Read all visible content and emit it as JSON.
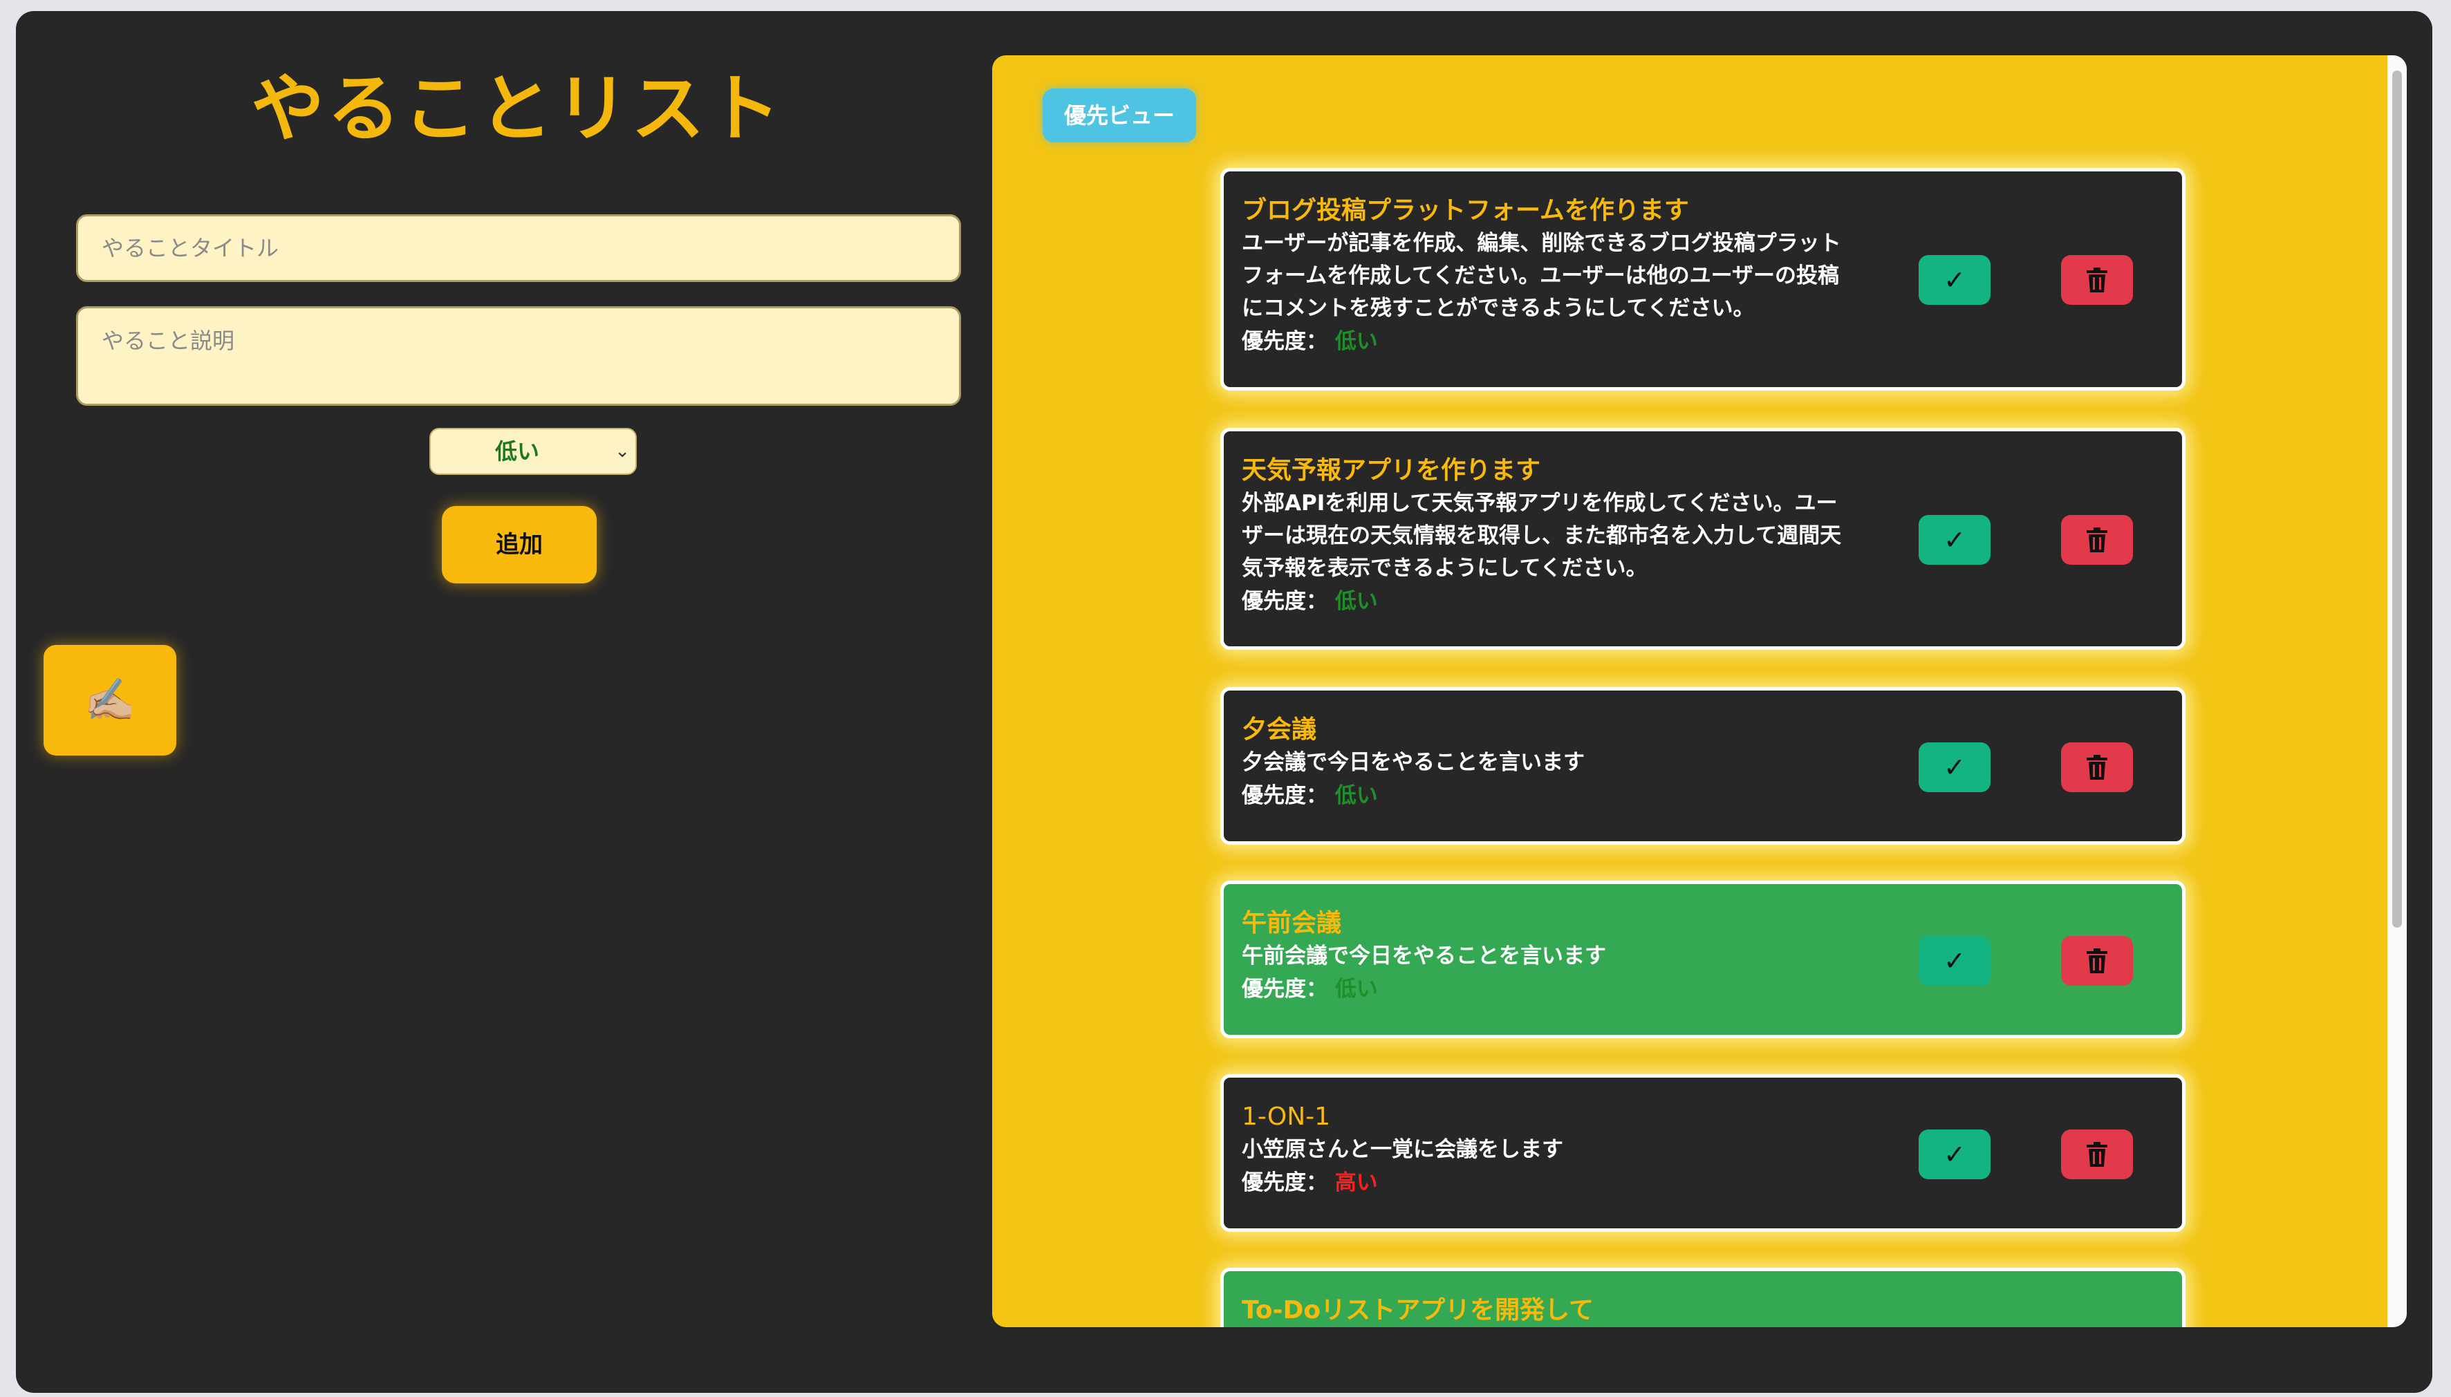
{
  "app": {
    "title": "やることリスト",
    "title_placeholder": "やることタイトル",
    "description_placeholder": "やること説明",
    "priority_selected": "低い",
    "add_label": "追加",
    "fab_icon": "writing-hand-icon",
    "fab_glyph": "✍🏼"
  },
  "list": {
    "view_button_label": "優先ビュー",
    "priority_prefix": "優先度：",
    "check_glyph": "✓",
    "items": [
      {
        "title": "ブログ投稿プラットフォームを作ります",
        "description": "ユーザーが記事を作成、編集、削除できるブログ投稿プラットフォームを作成してください。ユーザーは他のユーザーの投稿にコメントを残すことができるようにしてください。",
        "priority": "低い",
        "completed": false
      },
      {
        "title": "天気予報アプリを作ります",
        "description": "外部APIを利用して天気予報アプリを作成してください。ユーザーは現在の天気情報を取得し、また都市名を入力して週間天気予報を表示できるようにしてください。",
        "priority": "低い",
        "completed": false
      },
      {
        "title": "夕会議",
        "description": "夕会議で今日をやることを言います",
        "priority": "低い",
        "completed": false
      },
      {
        "title": "午前会議",
        "description": "午前会議で今日をやることを言います",
        "priority": "低い",
        "completed": true
      },
      {
        "title": "1-ON-1",
        "description": "小笠原さんと一覚に会議をします",
        "priority": "高い",
        "completed": false
      },
      {
        "title": "To-Doリストアプリを開発して",
        "completed": true
      }
    ]
  },
  "colors": {
    "accent": "#f8b90c",
    "panel": "#f2c413",
    "card_dark": "#272727",
    "card_done": "#35a853",
    "check": "#14b382",
    "delete": "#e33a4b",
    "view_button": "#4ec4e2",
    "priority_low": "#1f8f2a",
    "priority_high": "#ff1e1e"
  }
}
